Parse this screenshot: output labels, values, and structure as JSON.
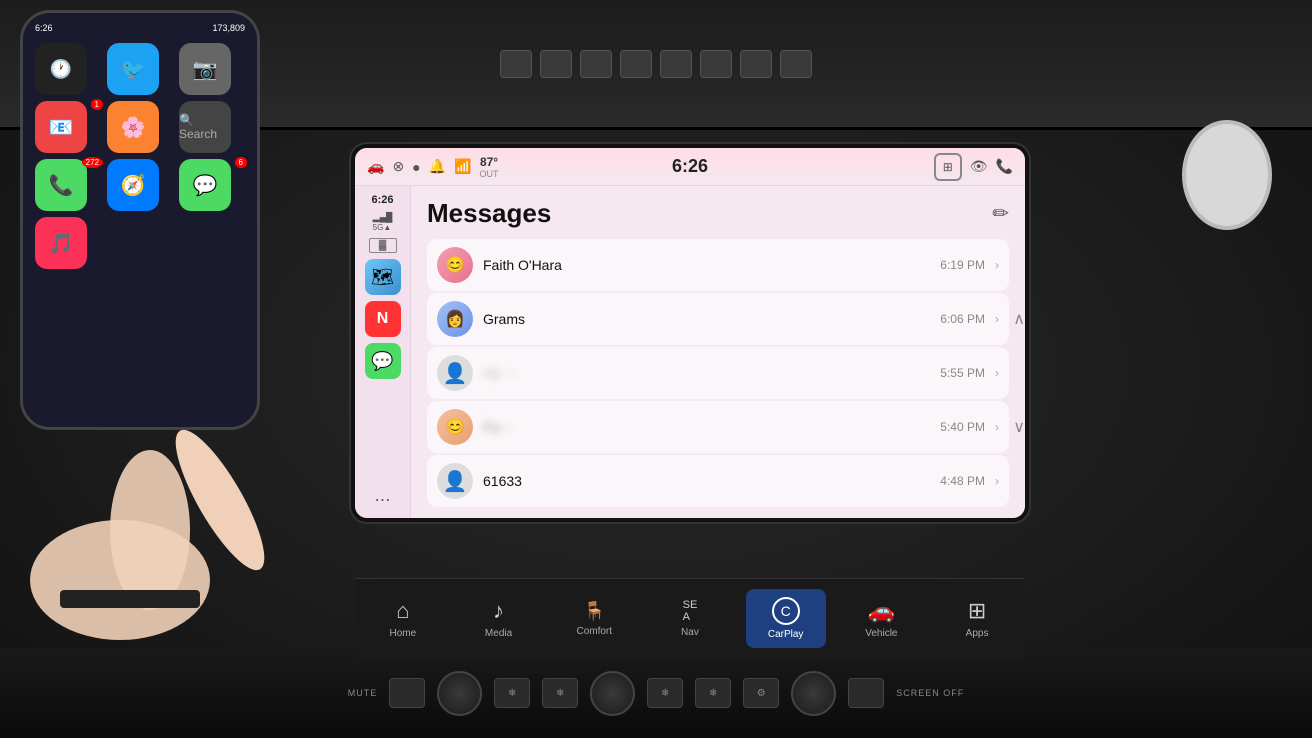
{
  "carplay": {
    "status_bar": {
      "time": "6:26",
      "temperature": "87°",
      "temp_label": "OUT",
      "icons": [
        "🚗",
        "⊗",
        "●",
        "🔔",
        "📶"
      ]
    },
    "sidebar": {
      "time": "6:26",
      "signal": "5G▲",
      "apps": [
        {
          "name": "maps",
          "icon": "🗺",
          "bg": "#ff6b6b"
        },
        {
          "name": "news",
          "icon": "N",
          "bg": "#ff3333"
        },
        {
          "name": "messages",
          "icon": "💬",
          "bg": "#4cd964"
        }
      ]
    },
    "messages": {
      "title": "Messages",
      "conversations": [
        {
          "name": "Faith O'Hara",
          "time": "6:19 PM",
          "avatar_type": "faith"
        },
        {
          "name": "Grams",
          "time": "6:06 PM",
          "avatar_type": "grams"
        },
        {
          "name": "+1 ···",
          "time": "5:55 PM",
          "avatar_type": "unknown",
          "blurred": true
        },
        {
          "name": "Fa···",
          "time": "5:40 PM",
          "avatar_type": "fa",
          "blurred": true
        },
        {
          "name": "61633",
          "time": "4:48 PM",
          "avatar_type": "num"
        }
      ]
    }
  },
  "nav_bar": {
    "items": [
      {
        "id": "home",
        "label": "Home",
        "icon": "⌂",
        "active": false
      },
      {
        "id": "media",
        "label": "Media",
        "icon": "♪",
        "active": false
      },
      {
        "id": "comfort",
        "label": "Comfort",
        "icon": "✦",
        "active": false
      },
      {
        "id": "nav",
        "label": "Nav",
        "sub": "SE A",
        "icon": "SE\nA",
        "active": false
      },
      {
        "id": "carplay",
        "label": "CarPlay",
        "icon": "C",
        "active": true
      },
      {
        "id": "vehicle",
        "label": "Vehicle",
        "icon": "🚗",
        "active": false
      },
      {
        "id": "apps",
        "label": "Apps",
        "icon": "⊞",
        "active": false
      }
    ]
  },
  "bottom_controls": {
    "mute_label": "MUTE",
    "screen_off_label": "SCREEN\nOFF"
  },
  "phone": {
    "apps": [
      {
        "icon": "🕐",
        "bg": "#222",
        "label": "clock"
      },
      {
        "icon": "🐦",
        "bg": "#1da1f2",
        "label": "twitter"
      },
      {
        "icon": "📷",
        "bg": "#888",
        "label": "camera"
      },
      {
        "icon": "📧",
        "bg": "#e44",
        "label": "mail",
        "badge": "1"
      },
      {
        "icon": "🎨",
        "bg": "#fa8231",
        "label": "photos"
      },
      {
        "icon": "📱",
        "bg": "#444",
        "label": "phone"
      },
      {
        "icon": "📞",
        "bg": "#4cd964",
        "label": "phone",
        "badge": "272"
      },
      {
        "icon": "🧭",
        "bg": "#007aff",
        "label": "safari"
      },
      {
        "icon": "💬",
        "bg": "#4cd964",
        "label": "messages",
        "badge": "6"
      },
      {
        "icon": "🎵",
        "bg": "#fc3158",
        "label": "music"
      }
    ]
  }
}
